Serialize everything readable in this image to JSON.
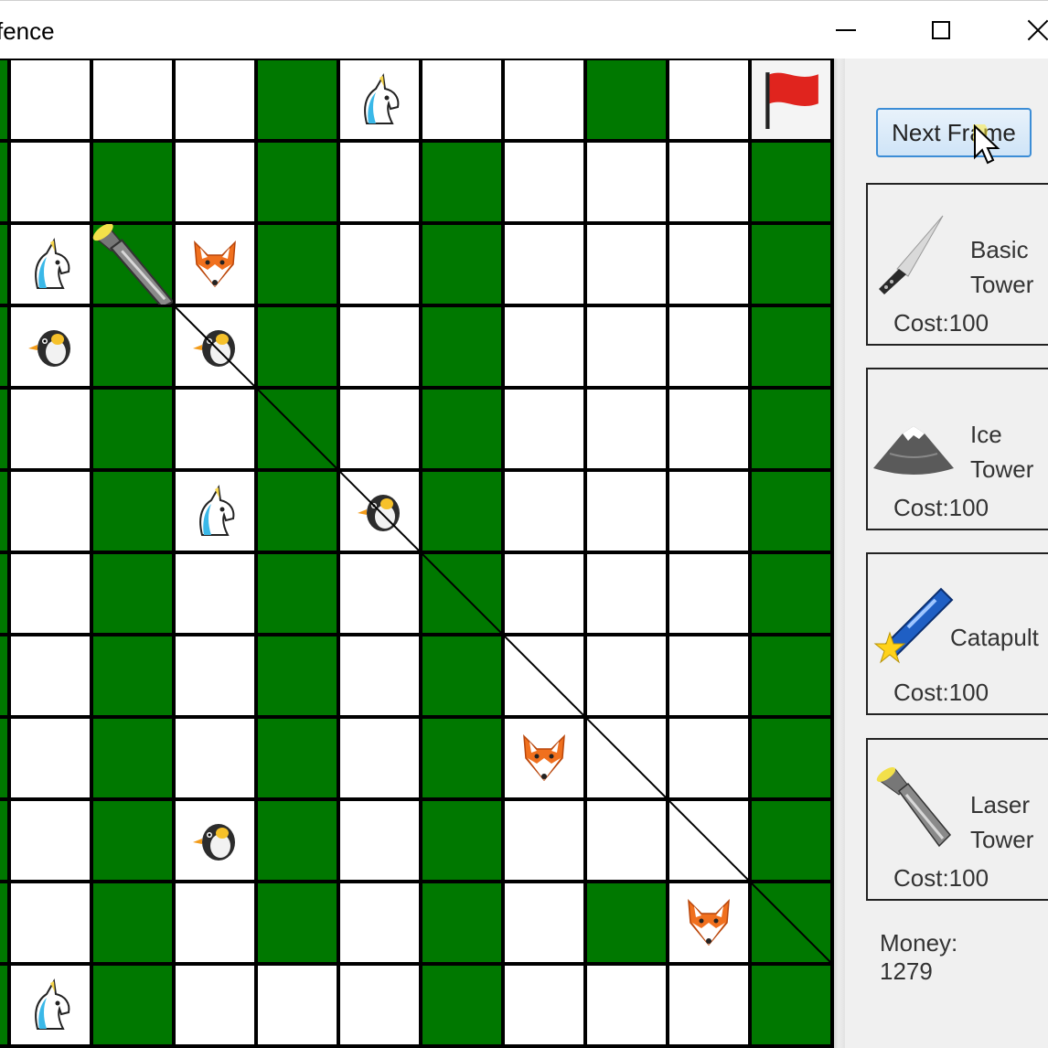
{
  "window": {
    "title": "fence"
  },
  "grid": {
    "columns": 10,
    "rows": 12,
    "pattern": [
      "wwwgwwwgwf",
      "wgwgwgwwwg",
      "wgwgwgwwwg",
      "wgwgwgwwwg",
      "wgwgwgwwwg",
      "wgwgwgwwwg",
      "wgwgwgwwwg",
      "wgwgwgwwwg",
      "wgwgwgwwwg",
      "wgwgwgwwwg",
      "wgwgwgwgwg",
      "wgwwwgwwwg"
    ],
    "colors": {
      "path": "#007800",
      "tile": "#ffffff",
      "gridline": "#000000"
    }
  },
  "units": [
    {
      "kind": "unicorn",
      "row": 0,
      "col": 4
    },
    {
      "kind": "flag",
      "row": 0,
      "col": 9
    },
    {
      "kind": "unicorn",
      "row": 2,
      "col": 0
    },
    {
      "kind": "laser-tower",
      "row": 2,
      "col": 1
    },
    {
      "kind": "fox",
      "row": 2,
      "col": 2
    },
    {
      "kind": "penguin",
      "row": 3,
      "col": 0
    },
    {
      "kind": "penguin",
      "row": 3,
      "col": 2
    },
    {
      "kind": "unicorn",
      "row": 5,
      "col": 2
    },
    {
      "kind": "penguin",
      "row": 5,
      "col": 4
    },
    {
      "kind": "fox",
      "row": 8,
      "col": 6
    },
    {
      "kind": "penguin",
      "row": 9,
      "col": 2
    },
    {
      "kind": "fox",
      "row": 10,
      "col": 8
    },
    {
      "kind": "unicorn",
      "row": 11,
      "col": 0
    }
  ],
  "laser_beam": {
    "from_cell": [
      2,
      1
    ],
    "to_cell": [
      10,
      9
    ]
  },
  "sidebar": {
    "next_frame_label": "Next Frame",
    "towers": [
      {
        "icon": "knife-icon",
        "name": "Basic Tower",
        "line1": "Basic",
        "line2": "Tower",
        "cost_label": "Cost:100"
      },
      {
        "icon": "mountain-icon",
        "name": "Ice Tower",
        "line1": "Ice",
        "line2": "Tower",
        "cost_label": "Cost:100"
      },
      {
        "icon": "catapult-icon",
        "name": "Catapult",
        "line1": "Catapult",
        "line2": "",
        "cost_label": "Cost:100"
      },
      {
        "icon": "flashlight-icon",
        "name": "Laser Tower",
        "line1": "Laser",
        "line2": "Tower",
        "cost_label": "Cost:100"
      }
    ],
    "money_label": "Money:",
    "money_value": "1279"
  }
}
